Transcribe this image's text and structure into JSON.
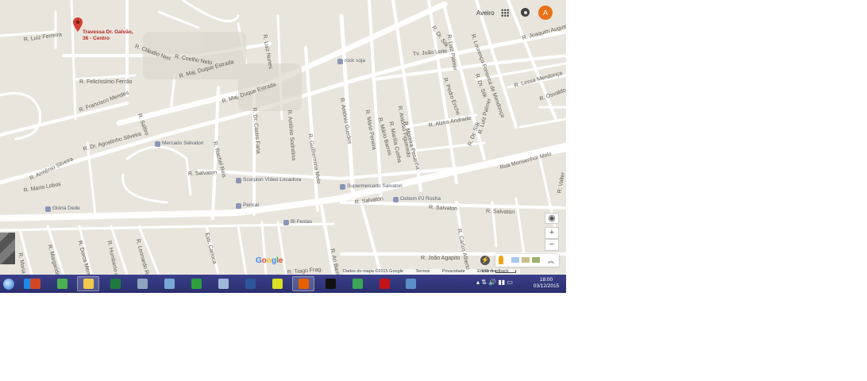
{
  "header": {
    "user_link": "Aveiro",
    "avatar_initial": "A",
    "apps_icon": "apps-grid-icon",
    "notifications_icon": "notifications-icon"
  },
  "marker": {
    "label": "Travessa Dr. Galvão, 36 - Centro",
    "icon": "red-pin-icon",
    "color": "#d23f31"
  },
  "streets": [
    {
      "name": "R. Luiz Ferreira"
    },
    {
      "name": "R. Coelho Neto"
    },
    {
      "name": "R. Cláudio Neri"
    },
    {
      "name": "R. Felicíssimo Ferrão"
    },
    {
      "name": "R. Luiz Nunes"
    },
    {
      "name": "R. Maj. Duque Estrada"
    },
    {
      "name": "R. Francisco Mendes"
    },
    {
      "name": "R. Dr. Agostinho Silveira"
    },
    {
      "name": "R. Armênio Silveira"
    },
    {
      "name": "R. Maria Lobos"
    },
    {
      "name": "R. Saltiro"
    },
    {
      "name": "R. Dr. Castro Faria"
    },
    {
      "name": "R. Antônio Sodrelina"
    },
    {
      "name": "R. Guilhermina Melo"
    },
    {
      "name": "R. Antônio Guedes"
    },
    {
      "name": "R. Mário Pereira"
    },
    {
      "name": "R. Mário Barros"
    },
    {
      "name": "R. Marília Cunha"
    },
    {
      "name": "R. Antônio Figueredo"
    },
    {
      "name": "R. Moreira Pesanha"
    },
    {
      "name": "Tv. João Leite"
    },
    {
      "name": "R. Dr. Silk"
    },
    {
      "name": "R. Luiz Palmer"
    },
    {
      "name": "R. Lourenço Fonseca de Mendonça"
    },
    {
      "name": "R. Joaquim Augusto"
    },
    {
      "name": "R. Lessa Mendonça"
    },
    {
      "name": "R. Osvaldo"
    },
    {
      "name": "R. Alzira Andrade"
    },
    {
      "name": "R. Luiz Palmer"
    },
    {
      "name": "R. Dr. Silk"
    },
    {
      "name": "Rua Monsenhor Melo"
    },
    {
      "name": "R. Salvaton"
    },
    {
      "name": "R. Salvaton"
    },
    {
      "name": "R. Salvaton"
    },
    {
      "name": "R. Salvaton"
    },
    {
      "name": "R. Maria Gaddo"
    },
    {
      "name": "R. Margarida Duarte"
    },
    {
      "name": "R. Dorca Mendes"
    },
    {
      "name": "R. Humberto de Gusmão"
    },
    {
      "name": "R. Leonardo Romeu"
    },
    {
      "name": "Estr. Carioca"
    },
    {
      "name": "R. Rachel Reis"
    },
    {
      "name": "R. Ari Barroso"
    },
    {
      "name": "R. Carlos Alberto"
    },
    {
      "name": "R. João Agapito"
    },
    {
      "name": "R. Tiago Frag."
    },
    {
      "name": "R. Valter"
    },
    {
      "name": "R. Maj. Duque Estrada"
    },
    {
      "name": "R. Pedro Eriche"
    },
    {
      "name": "R. Dr. Silk"
    }
  ],
  "pois": [
    {
      "name": "rock soja"
    },
    {
      "name": "Mercado Salvatori"
    },
    {
      "name": "Scorpion Vídeo Locadora"
    },
    {
      "name": "Supermercado Salvatori"
    },
    {
      "name": "Pericar"
    },
    {
      "name": "Bi Festas"
    },
    {
      "name": "Oxbom PJ Rocha"
    },
    {
      "name": "Glória Dede"
    }
  ],
  "map_footer": {
    "logo": "Google",
    "attribution": "Dados do mapa ©2015 Google",
    "terms": "Termos",
    "privacy": "Privacidade",
    "feedback": "Enviar feedback",
    "scale": "100 m"
  },
  "controls": {
    "zoom_in": "+",
    "zoom_out": "−",
    "my_location_icon": "my-location-icon",
    "expand_icon": "chevron-up-icon"
  },
  "taskbar": {
    "apps": [
      {
        "icon": "internet-explorer-icon",
        "color": "#1e88e5"
      },
      {
        "icon": "powerpoint-icon",
        "color": "#d24726"
      },
      {
        "icon": "chrome-icon",
        "color": "#4caf50"
      },
      {
        "icon": "file-explorer-icon",
        "color": "#f2c94c",
        "active": true
      },
      {
        "icon": "excel-icon",
        "color": "#1f7a3d"
      },
      {
        "icon": "calculator-icon",
        "color": "#90a4c0"
      },
      {
        "icon": "notes-icon",
        "color": "#7aa6d8"
      },
      {
        "icon": "project-green-icon",
        "color": "#2e9e3e"
      },
      {
        "icon": "paint-icon",
        "color": "#a0b8d8"
      },
      {
        "icon": "word-icon",
        "color": "#2b579a"
      },
      {
        "icon": "ve-app-icon",
        "color": "#d9e021"
      },
      {
        "icon": "firefox-icon",
        "color": "#e66000",
        "active": true
      },
      {
        "icon": "command-prompt-icon",
        "color": "#111111"
      },
      {
        "icon": "app-green-icon",
        "color": "#3aa655"
      },
      {
        "icon": "acrobat-reader-icon",
        "color": "#c4121a"
      },
      {
        "icon": "image-viewer-icon",
        "color": "#5b8fc7"
      }
    ],
    "clock": {
      "time": "18:00",
      "date": "03/12/2015"
    }
  }
}
